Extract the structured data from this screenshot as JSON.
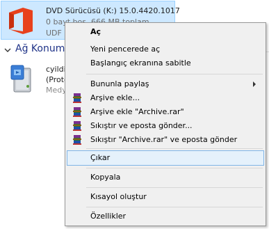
{
  "drive": {
    "name": "DVD Sürücüsü (K:) 15.0.4420.1017",
    "free_space": "0 bayt boş, 666 MB toplam",
    "filesystem": "UDF",
    "icon": "office-logo-icon"
  },
  "network_section": {
    "title": "Ağ Konumu",
    "item": {
      "name": "cyildi",
      "protocol": "(Prote",
      "type": "Medy",
      "icon": "media-server-icon"
    }
  },
  "context_menu": {
    "open": "Aç",
    "open_new_window": "Yeni pencerede aç",
    "pin_start": "Başlangıç ekranına sabitle",
    "share_with": "Bununla paylaş",
    "add_to_archive": "Arşive ekle...",
    "add_to_archive_rar": "Arşive ekle \"Archive.rar\"",
    "compress_email": "Sıkıştır ve eposta gönder...",
    "compress_rar_email": "Sıkıştır \"Archive.rar\" ve eposta gönder",
    "eject": "Çıkar",
    "copy": "Kopyala",
    "create_shortcut": "Kısayol oluştur",
    "properties": "Özellikler",
    "winrar_icon": "winrar-icon"
  }
}
